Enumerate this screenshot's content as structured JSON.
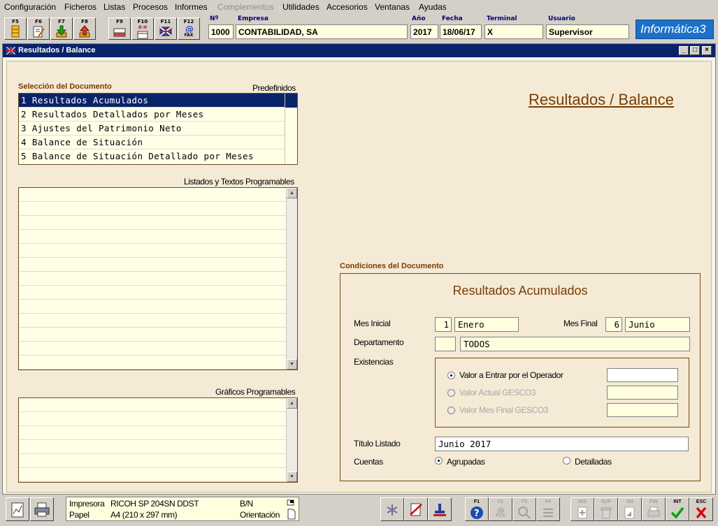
{
  "menu": [
    "Configuración",
    "Ficheros",
    "Listas",
    "Procesos",
    "Informes",
    "Complementos",
    "Utilidades",
    "Accesorios",
    "Ventanas",
    "Ayudas"
  ],
  "menu_disabled": "Complementos",
  "toolbar": {
    "f5": "F5",
    "f6": "F6",
    "f7": "F7",
    "f8": "F8",
    "f9": "F9",
    "f10": "F10",
    "f11": "F11",
    "f12": "F12",
    "f10_sub": "D H",
    "f12_sub": "FAX"
  },
  "header": {
    "num_label": "Nº",
    "num": "1000",
    "empresa_label": "Empresa",
    "empresa": "CONTABILIDAD, SA",
    "anio_label": "Año",
    "anio": "2017",
    "fecha_label": "Fecha",
    "fecha": "18/06/17",
    "terminal_label": "Terminal",
    "terminal": "X",
    "usuario_label": "Usuario",
    "usuario": "Supervisor",
    "logo_text": "Informática3"
  },
  "window": {
    "title": "Resultados / Balance",
    "heading": "Resultados / Balance"
  },
  "seleccion": {
    "label": "Selección del Documento",
    "predefinidos": "Predefinidos",
    "items": [
      "1 Resultados Acumulados",
      "2 Resultados Detallados por Meses",
      "3 Ajustes del Patrimonio Neto",
      "4 Balance de Situación",
      "5 Balance de Situación Detallado por Meses"
    ]
  },
  "listados": {
    "label": "Listados y Textos Programables"
  },
  "graficos": {
    "label": "Gráficos Programables"
  },
  "condiciones": {
    "label": "Condiciones del Documento",
    "title": "Resultados Acumulados",
    "mes_inicial_label": "Mes Inicial",
    "mes_inicial_num": "1",
    "mes_inicial": "Enero",
    "mes_final_label": "Mes Final",
    "mes_final_num": "6",
    "mes_final": "Junio",
    "departamento_label": "Departamento",
    "departamento_num": "",
    "departamento": "TODOS",
    "existencias_label": "Existencias",
    "existencias_options": [
      "Valor a Entrar por el Operador",
      "Valor Actual GESCO3",
      "Valor Mes Final GESCO3"
    ],
    "titulo_label": "Título Listado",
    "titulo": "Junio 2017",
    "cuentas_label": "Cuentas",
    "cuentas_agrupadas": "Agrupadas",
    "cuentas_detalladas": "Detalladas"
  },
  "printer": {
    "impresora_label": "Impresora",
    "impresora": "RICOH SP 204SN DDST",
    "bn": "B/N",
    "papel_label": "Papel",
    "papel": "A4 (210 x 297 mm)",
    "orientacion": "Orientación"
  },
  "statusbar": {
    "f1": "F1",
    "f2": "F2",
    "f2_sub": "FAX",
    "f3": "F3",
    "f4": "F4",
    "ins": "INS",
    "sup": "SUP",
    "ini": "INI",
    "fin": "FIN",
    "int": "INT",
    "esc": "ESC"
  }
}
